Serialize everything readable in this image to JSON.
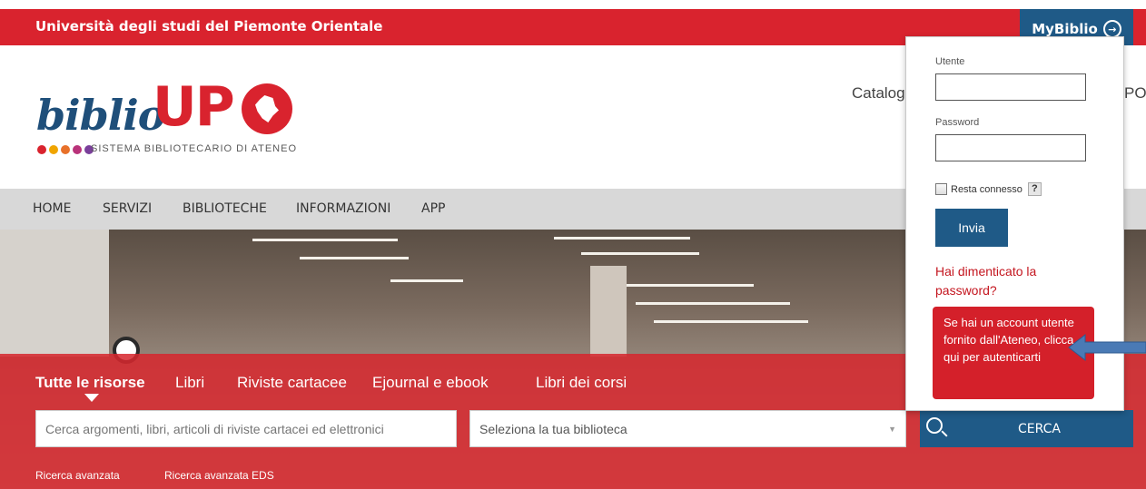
{
  "header": {
    "university": "Università degli studi del Piemonte Orientale",
    "mybiblio_label": "MyBiblio",
    "login_icon": "login-icon"
  },
  "logo": {
    "word_biblio": "biblio",
    "word_up": "UP",
    "tagline": "SISTEMA BIBLIOTECARIO DI ATENEO",
    "dot_colors": [
      "#d9232e",
      "#f0a500",
      "#e8712a",
      "#b9337a",
      "#7a3f9a"
    ]
  },
  "top_links": {
    "catalog": "Catalog",
    "right_fragment": "PO"
  },
  "nav": {
    "items": [
      "HOME",
      "SERVIZI",
      "BIBLIOTECHE",
      "INFORMAZIONI",
      "APP"
    ]
  },
  "search": {
    "tabs": [
      "Tutte le risorse",
      "Libri",
      "Riviste cartacee",
      "Ejournal e ebook",
      "Libri dei corsi"
    ],
    "active_tab": "Tutte le risorse",
    "input_placeholder": "Cerca argomenti, libri, articoli di riviste cartacei ed elettronici",
    "select_value": "Seleziona la tua biblioteca",
    "search_button": "CERCA",
    "advanced": "Ricerca avanzata",
    "advanced_eds": "Ricerca avanzata EDS"
  },
  "login": {
    "user_label": "Utente",
    "password_label": "Password",
    "remember_label": "Resta connesso",
    "help": "?",
    "submit_label": "Invia",
    "forgot_label": "Hai dimenticato la password?",
    "tooltip": "Se hai un account utente fornito dall'Ateneo, clicca qui per autenticarti"
  },
  "colors": {
    "brand_red": "#d9232e",
    "brand_blue": "#1f5a87",
    "arrow_blue": "#4a7ab5"
  }
}
